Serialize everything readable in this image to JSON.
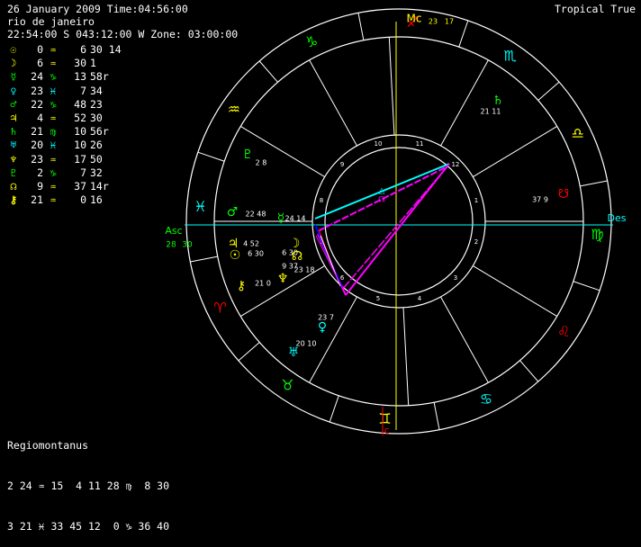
{
  "header": {
    "line1": "26 January 2009 Time:04:56:00",
    "line2": "rio de janeiro",
    "line3": "22:54:00 S 043:12:00 W Zone: 03:00:00",
    "mode": "Tropical True"
  },
  "planets": [
    {
      "glyph": "☉",
      "deg": "0",
      "sign": "♒",
      "min": "6",
      "sec": "30 14",
      "color": "#ffff00",
      "sign_color": "#ffff00"
    },
    {
      "glyph": "☽",
      "deg": "6",
      "sign": "♒",
      "min": "30",
      "sec": "1",
      "color": "#ffff00",
      "sign_color": "#ffff00"
    },
    {
      "glyph": "☿",
      "deg": "24",
      "sign": "♑",
      "min": "13",
      "sec": "58r",
      "color": "#00ff00",
      "sign_color": "#00ff00"
    },
    {
      "glyph": "♀",
      "deg": "23",
      "sign": "♓",
      "min": "7",
      "sec": "34",
      "color": "#00ffff",
      "sign_color": "#00ffff"
    },
    {
      "glyph": "♂",
      "deg": "22",
      "sign": "♑",
      "min": "48",
      "sec": "23",
      "color": "#00ff00",
      "sign_color": "#00ff00"
    },
    {
      "glyph": "♃",
      "deg": "4",
      "sign": "♒",
      "min": "52",
      "sec": "30",
      "color": "#ffff00",
      "sign_color": "#ffff00"
    },
    {
      "glyph": "♄",
      "deg": "21",
      "sign": "♍",
      "min": "10",
      "sec": "56r",
      "color": "#00ff00",
      "sign_color": "#00ff00"
    },
    {
      "glyph": "♅",
      "deg": "20",
      "sign": "♓",
      "min": "10",
      "sec": "26",
      "color": "#00ffff",
      "sign_color": "#00ffff"
    },
    {
      "glyph": "♆",
      "deg": "23",
      "sign": "♒",
      "min": "17",
      "sec": "50",
      "color": "#ffff00",
      "sign_color": "#ffff00"
    },
    {
      "glyph": "♇",
      "deg": "2",
      "sign": "♑",
      "min": "7",
      "sec": "32",
      "color": "#00ff00",
      "sign_color": "#00ff00"
    },
    {
      "glyph": "☊",
      "deg": "9",
      "sign": "♒",
      "min": "37",
      "sec": "14r",
      "color": "#ffff00",
      "sign_color": "#ffff00"
    },
    {
      "glyph": "⚷",
      "deg": "21",
      "sign": "♒",
      "min": "0",
      "sec": "16",
      "color": "#ffff00",
      "sign_color": "#ffff00"
    }
  ],
  "regio": {
    "title": "Regiomontanus",
    "row1": "2 24 ♒ 15  4 11 28 ♍  8 30",
    "row2": "3 21 ♓ 33 45 12  0 ♑ 36 40"
  },
  "wheel": {
    "asc_label": "Asc",
    "asc_deg": "28",
    "asc_min": "30",
    "mc_label": "Mc",
    "mc_deg": "23",
    "mc_min": "17",
    "des_label": "Des",
    "ic_label": "Ic",
    "house_numbers": [
      "1",
      "2",
      "3",
      "4",
      "5",
      "6",
      "7",
      "8",
      "9",
      "10",
      "11",
      "12"
    ],
    "zodiac": [
      {
        "glyph": "♈",
        "color": "#ff0000"
      },
      {
        "glyph": "♉",
        "color": "#00ff00"
      },
      {
        "glyph": "♊",
        "color": "#ffff00"
      },
      {
        "glyph": "♋",
        "color": "#00ffff"
      },
      {
        "glyph": "♌",
        "color": "#ff0000"
      },
      {
        "glyph": "♍",
        "color": "#00ff00"
      },
      {
        "glyph": "♎",
        "color": "#ffff00"
      },
      {
        "glyph": "♏",
        "color": "#00ffff"
      },
      {
        "glyph": "♐",
        "color": "#ff0000"
      },
      {
        "glyph": "♑",
        "color": "#00ff00"
      },
      {
        "glyph": "♒",
        "color": "#ffff00"
      },
      {
        "glyph": "♓",
        "color": "#00ffff"
      }
    ],
    "wheel_planets": [
      {
        "glyph": "♇",
        "text": "2 8",
        "color": "#00ff00"
      },
      {
        "glyph": "♂",
        "text": "22 48",
        "color": "#00ff00"
      },
      {
        "glyph": "☿",
        "text": "24 14",
        "color": "#00ff00"
      },
      {
        "glyph": "♃",
        "text": "4 52",
        "color": "#ffff00"
      },
      {
        "glyph": "☉",
        "text": "6 30",
        "color": "#ffff00"
      },
      {
        "glyph": "☽",
        "text": "6 30",
        "color": "#ffff00"
      },
      {
        "glyph": "☊",
        "text": "9 37",
        "color": "#ffff00"
      },
      {
        "glyph": "♆",
        "text": "23 18",
        "color": "#ffff00"
      },
      {
        "glyph": "⚷",
        "text": "21 0",
        "color": "#ffff00"
      },
      {
        "glyph": "♀",
        "text": "23 7",
        "color": "#00ffff"
      },
      {
        "glyph": "♅",
        "text": "20 10",
        "color": "#00ffff"
      },
      {
        "glyph": "♄",
        "text": "21 11",
        "color": "#00ff00"
      },
      {
        "glyph": "☋",
        "text": "37 9",
        "color": "#ff0000"
      }
    ]
  }
}
